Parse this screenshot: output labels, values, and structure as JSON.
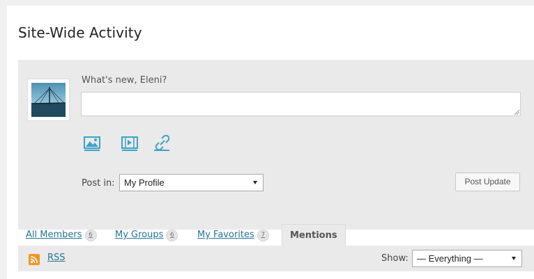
{
  "page": {
    "title": "Site-Wide Activity"
  },
  "post_form": {
    "whats_new": "What's new, Eleni?",
    "textarea_value": "",
    "media_icons": [
      "image-icon",
      "video-icon",
      "link-icon"
    ],
    "post_in_label": "Post in:",
    "post_in_selected": "My Profile",
    "submit_label": "Post Update"
  },
  "tabs": [
    {
      "label": "All Members",
      "count": "6"
    },
    {
      "label": "My Groups",
      "count": "6"
    },
    {
      "label": "My Favorites",
      "count": "7"
    },
    {
      "label": "Mentions",
      "active": true
    }
  ],
  "filter_bar": {
    "rss_label": "RSS",
    "show_label": "Show:",
    "show_selected": "— Everything —"
  },
  "colors": {
    "link": "#21759b",
    "panel": "#eaeaea",
    "rss": "#f7941d"
  }
}
